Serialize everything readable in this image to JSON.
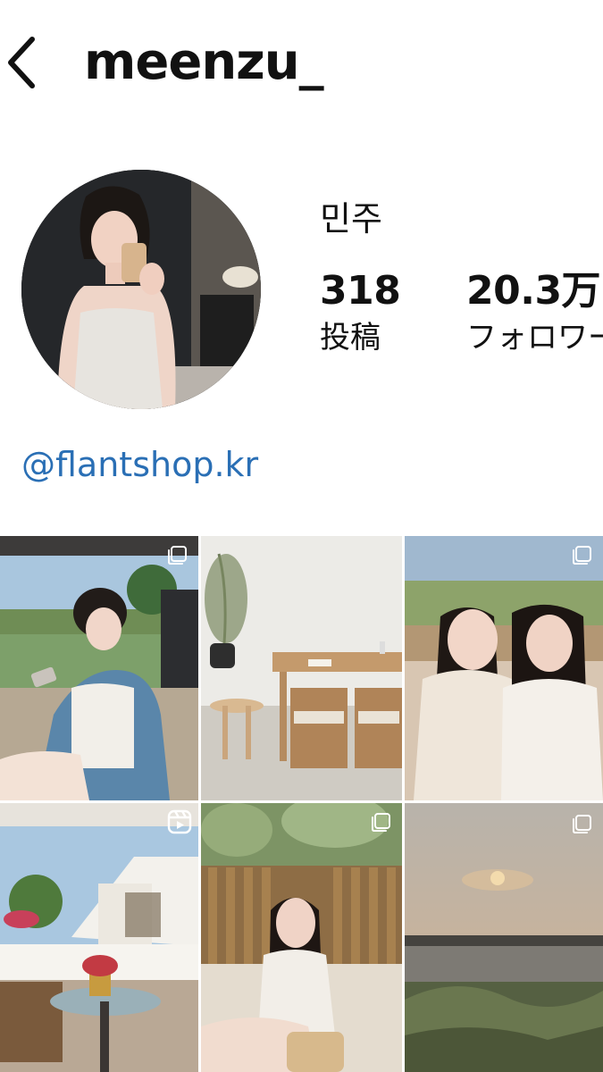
{
  "header": {
    "username": "meenzu_"
  },
  "profile": {
    "display_name": "민주",
    "stats": {
      "posts": {
        "count": "318",
        "label": "投稿"
      },
      "followers": {
        "count": "20.3万",
        "label": "フォロワー"
      }
    },
    "bio_link": "@flantshop.kr"
  },
  "posts": [
    {
      "type": "carousel",
      "icon": "multiple-photos-icon"
    },
    {
      "type": "photo"
    },
    {
      "type": "carousel",
      "icon": "multiple-photos-icon"
    },
    {
      "type": "reel",
      "icon": "reel-icon"
    },
    {
      "type": "carousel",
      "icon": "multiple-photos-icon"
    },
    {
      "type": "carousel",
      "icon": "multiple-photos-icon"
    }
  ],
  "colors": {
    "link": "#2a6fb5",
    "text": "#111111",
    "background": "#ffffff"
  }
}
